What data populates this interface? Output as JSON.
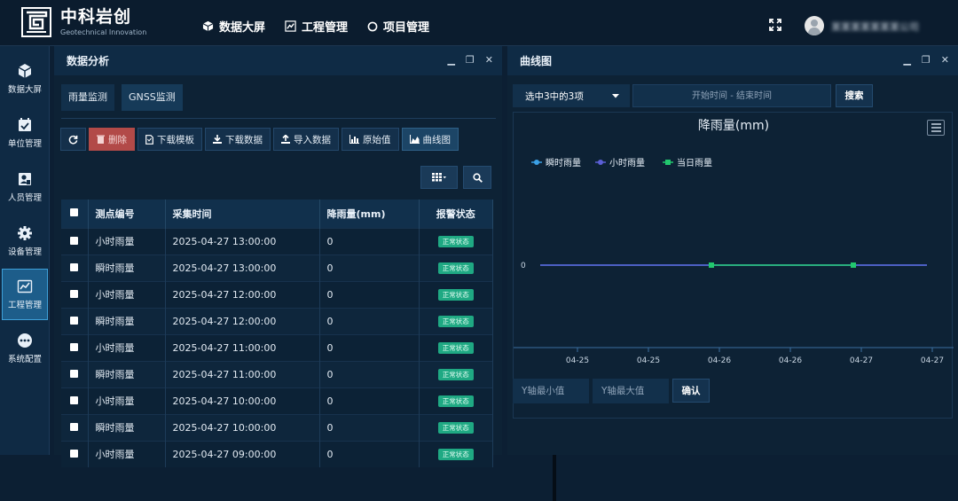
{
  "app": {
    "brand_cn": "中科岩创",
    "brand_en": "Geotechnical Innovation",
    "username": "某某某某某某某公司"
  },
  "nav": [
    {
      "label": "数据大屏",
      "icon": "cube-icon"
    },
    {
      "label": "工程管理",
      "icon": "chart-line-icon"
    },
    {
      "label": "项目管理",
      "icon": "circle-icon"
    }
  ],
  "sidebar": [
    {
      "label": "数据大屏",
      "icon": "cube-icon"
    },
    {
      "label": "单位管理",
      "icon": "calendar-check-icon"
    },
    {
      "label": "人员管理",
      "icon": "user-card-icon"
    },
    {
      "label": "设备管理",
      "icon": "gear-icon"
    },
    {
      "label": "工程管理",
      "icon": "chart-area-icon",
      "active": true
    },
    {
      "label": "系统配置",
      "icon": "dots-icon"
    }
  ],
  "left_panel": {
    "title": "数据分析",
    "tabs": [
      "雨量监测",
      "GNSS监测"
    ],
    "toolbar": {
      "delete": "删除",
      "download_template": "下载模板",
      "download_data": "下载数据",
      "import": "导入数据",
      "raw": "原始值",
      "curve": "曲线图"
    },
    "table": {
      "headers": [
        "测点编号",
        "采集时间",
        "降雨量(mm)",
        "报警状态"
      ],
      "rows": [
        [
          "小时雨量",
          "2025-04-27 13:00:00",
          "0",
          "正常状态"
        ],
        [
          "瞬时雨量",
          "2025-04-27 13:00:00",
          "0",
          "正常状态"
        ],
        [
          "小时雨量",
          "2025-04-27 12:00:00",
          "0",
          "正常状态"
        ],
        [
          "瞬时雨量",
          "2025-04-27 12:00:00",
          "0",
          "正常状态"
        ],
        [
          "小时雨量",
          "2025-04-27 11:00:00",
          "0",
          "正常状态"
        ],
        [
          "瞬时雨量",
          "2025-04-27 11:00:00",
          "0",
          "正常状态"
        ],
        [
          "小时雨量",
          "2025-04-27 10:00:00",
          "0",
          "正常状态"
        ],
        [
          "瞬时雨量",
          "2025-04-27 10:00:00",
          "0",
          "正常状态"
        ],
        [
          "小时雨量",
          "2025-04-27 09:00:00",
          "0",
          "正常状态"
        ]
      ]
    }
  },
  "right_panel": {
    "title": "曲线图",
    "select_value": "选中3中的3项",
    "date_placeholder": "开始时间 - 结束时间",
    "search": "搜索",
    "y_min_placeholder": "Y轴最小值",
    "y_max_placeholder": "Y轴最大值",
    "confirm": "确认"
  },
  "colors": {
    "series_instant": "#3ba1e6",
    "series_hour": "#5b5fd6",
    "series_day": "#22c86e",
    "badge": "#1fa983"
  },
  "chart_data": {
    "type": "line",
    "title": "降雨量(mm)",
    "x_ticks": [
      "04-25",
      "04-25",
      "04-26",
      "04-26",
      "04-27",
      "04-27"
    ],
    "y_ticks": [
      "0"
    ],
    "legend_position": "top-left",
    "series": [
      {
        "name": "瞬时雨量",
        "points": [
          [
            "04-25",
            0
          ],
          [
            "04-27",
            0
          ]
        ]
      },
      {
        "name": "小时雨量",
        "points": [
          [
            "04-25",
            0
          ],
          [
            "04-27",
            0
          ]
        ]
      },
      {
        "name": "当日雨量",
        "points": [
          [
            "04-26",
            0
          ],
          [
            "04-27",
            0
          ]
        ]
      }
    ]
  }
}
